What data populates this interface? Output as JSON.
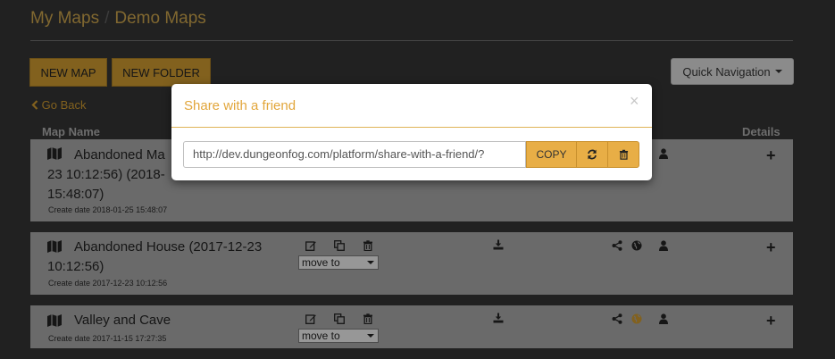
{
  "breadcrumb": {
    "root": "My Maps",
    "separator": "/",
    "current": "Demo Maps"
  },
  "toolbar": {
    "new_map": "NEW MAP",
    "new_folder": "NEW FOLDER",
    "quick_nav": "Quick Navigation"
  },
  "nav": {
    "go_back": "Go Back"
  },
  "table": {
    "col_map_name": "Map Name",
    "col_details": "Details"
  },
  "rows": [
    {
      "name_line1": "Abandoned Ma",
      "name_line2": "23 10:12:56) (2018-",
      "name_line3": "15:48:07)",
      "create_date": "Create date 2018-01-25 15:48:07"
    },
    {
      "name": "Abandoned House (2017-12-23 10:12:56)",
      "create_date": "Create date 2017-12-23 10:12:56",
      "move_to": "move to"
    },
    {
      "name": "Valley and Cave",
      "create_date": "Create date 2017-11-15 17:27:35",
      "move_to": "move to"
    }
  ],
  "modal": {
    "title": "Share with a friend",
    "close": "×",
    "url": "http://dev.dungeonfog.com/platform/share-with-a-friend/?",
    "copy": "COPY"
  },
  "colors": {
    "gold": "#c8952f",
    "modal_title": "#e2a63b",
    "row_bg": "#a3a3a3",
    "page_bg": "#333333"
  },
  "icons": [
    "map-icon",
    "edit-icon",
    "copy-icon",
    "trash-icon",
    "download-icon",
    "share-icon",
    "globe-icon",
    "user-icon",
    "plus-icon",
    "chevron-left-icon",
    "refresh-icon"
  ]
}
